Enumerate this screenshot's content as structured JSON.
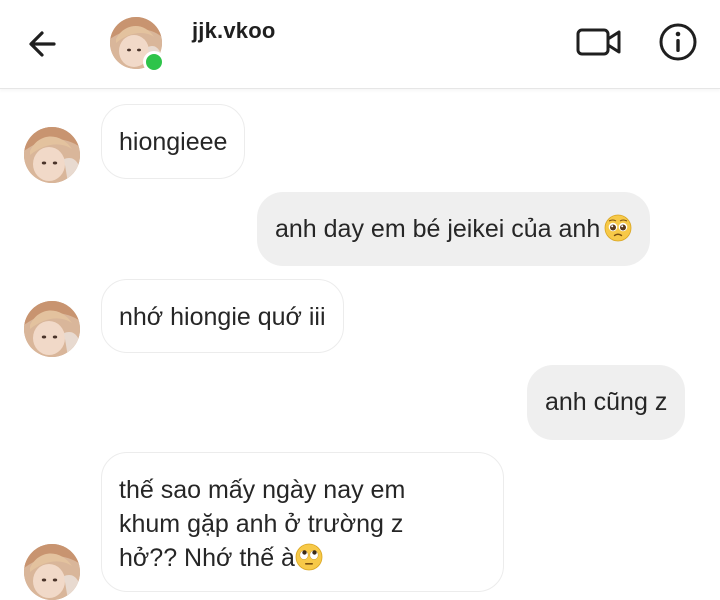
{
  "header": {
    "username": "jjk.vkoo",
    "status": "online"
  },
  "messages": [
    {
      "direction": "in",
      "text": "hiongieee"
    },
    {
      "direction": "out",
      "text": "anh day em bé jeikei của anh",
      "emoji": "pleading-face"
    },
    {
      "direction": "in",
      "text": "nhớ hiongie quớ iii"
    },
    {
      "direction": "out",
      "text": "anh cũng z"
    },
    {
      "direction": "in",
      "lines": [
        "thế sao mấy ngày nay em",
        "khum gặp anh ở trường z",
        "hở?? Nhớ thế à"
      ],
      "emoji": "rolling-eyes-face"
    }
  ],
  "colors": {
    "online": "#2ec44a",
    "outgoing_bubble": "#efefef",
    "incoming_border": "#ececec",
    "text": "#262626"
  }
}
